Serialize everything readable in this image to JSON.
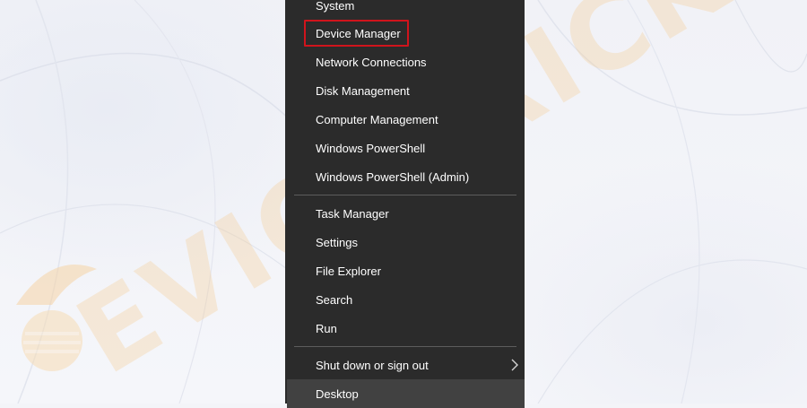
{
  "watermark": {
    "text": "EVICETRICKS"
  },
  "menu": {
    "items": [
      {
        "label": "System"
      },
      {
        "label": "Device Manager"
      },
      {
        "label": "Network Connections"
      },
      {
        "label": "Disk Management"
      },
      {
        "label": "Computer Management"
      },
      {
        "label": "Windows PowerShell"
      },
      {
        "label": "Windows PowerShell (Admin)"
      },
      {
        "label": "Task Manager"
      },
      {
        "label": "Settings"
      },
      {
        "label": "File Explorer"
      },
      {
        "label": "Search"
      },
      {
        "label": "Run"
      },
      {
        "label": "Shut down or sign out",
        "submenu": true,
        "submenu_icon": "chevron-right-icon"
      },
      {
        "label": "Desktop",
        "state": "hovered"
      }
    ]
  },
  "annotation": {
    "highlighted_item": "Device Manager",
    "highlight_color": "#d0141c"
  },
  "colors": {
    "menu_background": "#2b2b2b",
    "hover_background": "#414141",
    "separator": "#5c5c5c",
    "watermark": "#f4c98a"
  }
}
